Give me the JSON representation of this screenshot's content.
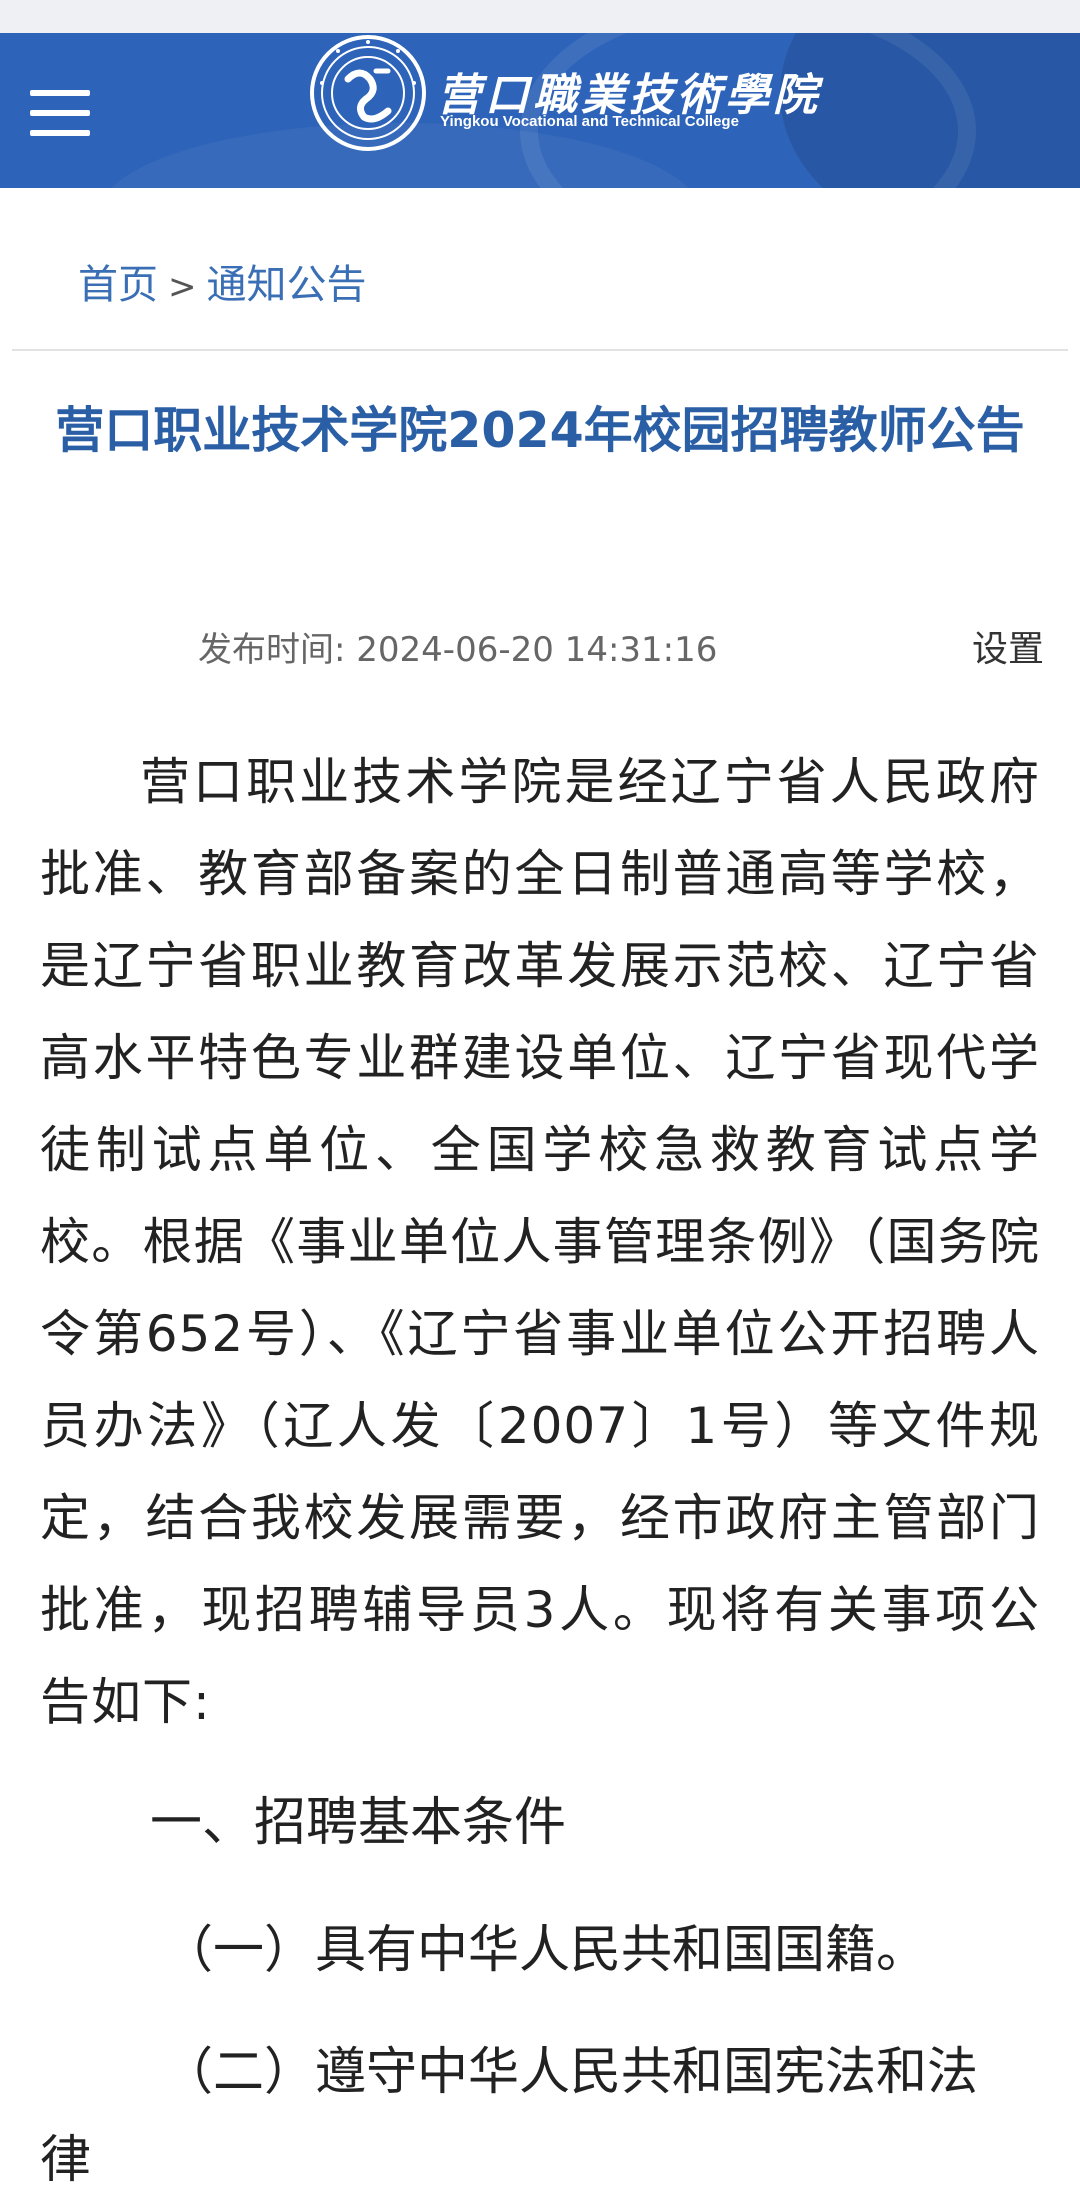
{
  "header": {
    "logo_cn": "营口職業技術學院",
    "logo_en": "Yingkou Vocational and Technical College",
    "brand_color": "#2d63b8"
  },
  "breadcrumb": {
    "home": "首页",
    "separator": ">",
    "current": "通知公告"
  },
  "article": {
    "title": "营口职业技术学院2024年校园招聘教师公告",
    "meta_label": "发布时间:",
    "publish_time": "2024-06-20 14:31:16",
    "settings_label": "设置",
    "paragraph": "营口职业技术学院是经辽宁省人民政府批准、教育部备案的全日制普通高等学校，是辽宁省职业教育改革发展示范校、辽宁省高水平特色专业群建设单位、辽宁省现代学徒制试点单位、全国学校急救教育试点学校。根据《事业单位人事管理条例》（国务院令第652号）、《辽宁省事业单位公开招聘人员办法》（辽人发〔2007〕1号）等文件规定，结合我校发展需要，经市政府主管部门批准，现招聘辅导员3人。现将有关事项公告如下:",
    "section1_heading": "一、招聘基本条件",
    "item1": "（一）具有中华人民共和国国籍。",
    "item2": "（二）遵守中华人民共和国宪法和法",
    "item2_cont": "律"
  },
  "colors": {
    "title": "#2a5fa6",
    "link": "#3b6fb5",
    "text": "#222222",
    "meta": "#666666"
  }
}
